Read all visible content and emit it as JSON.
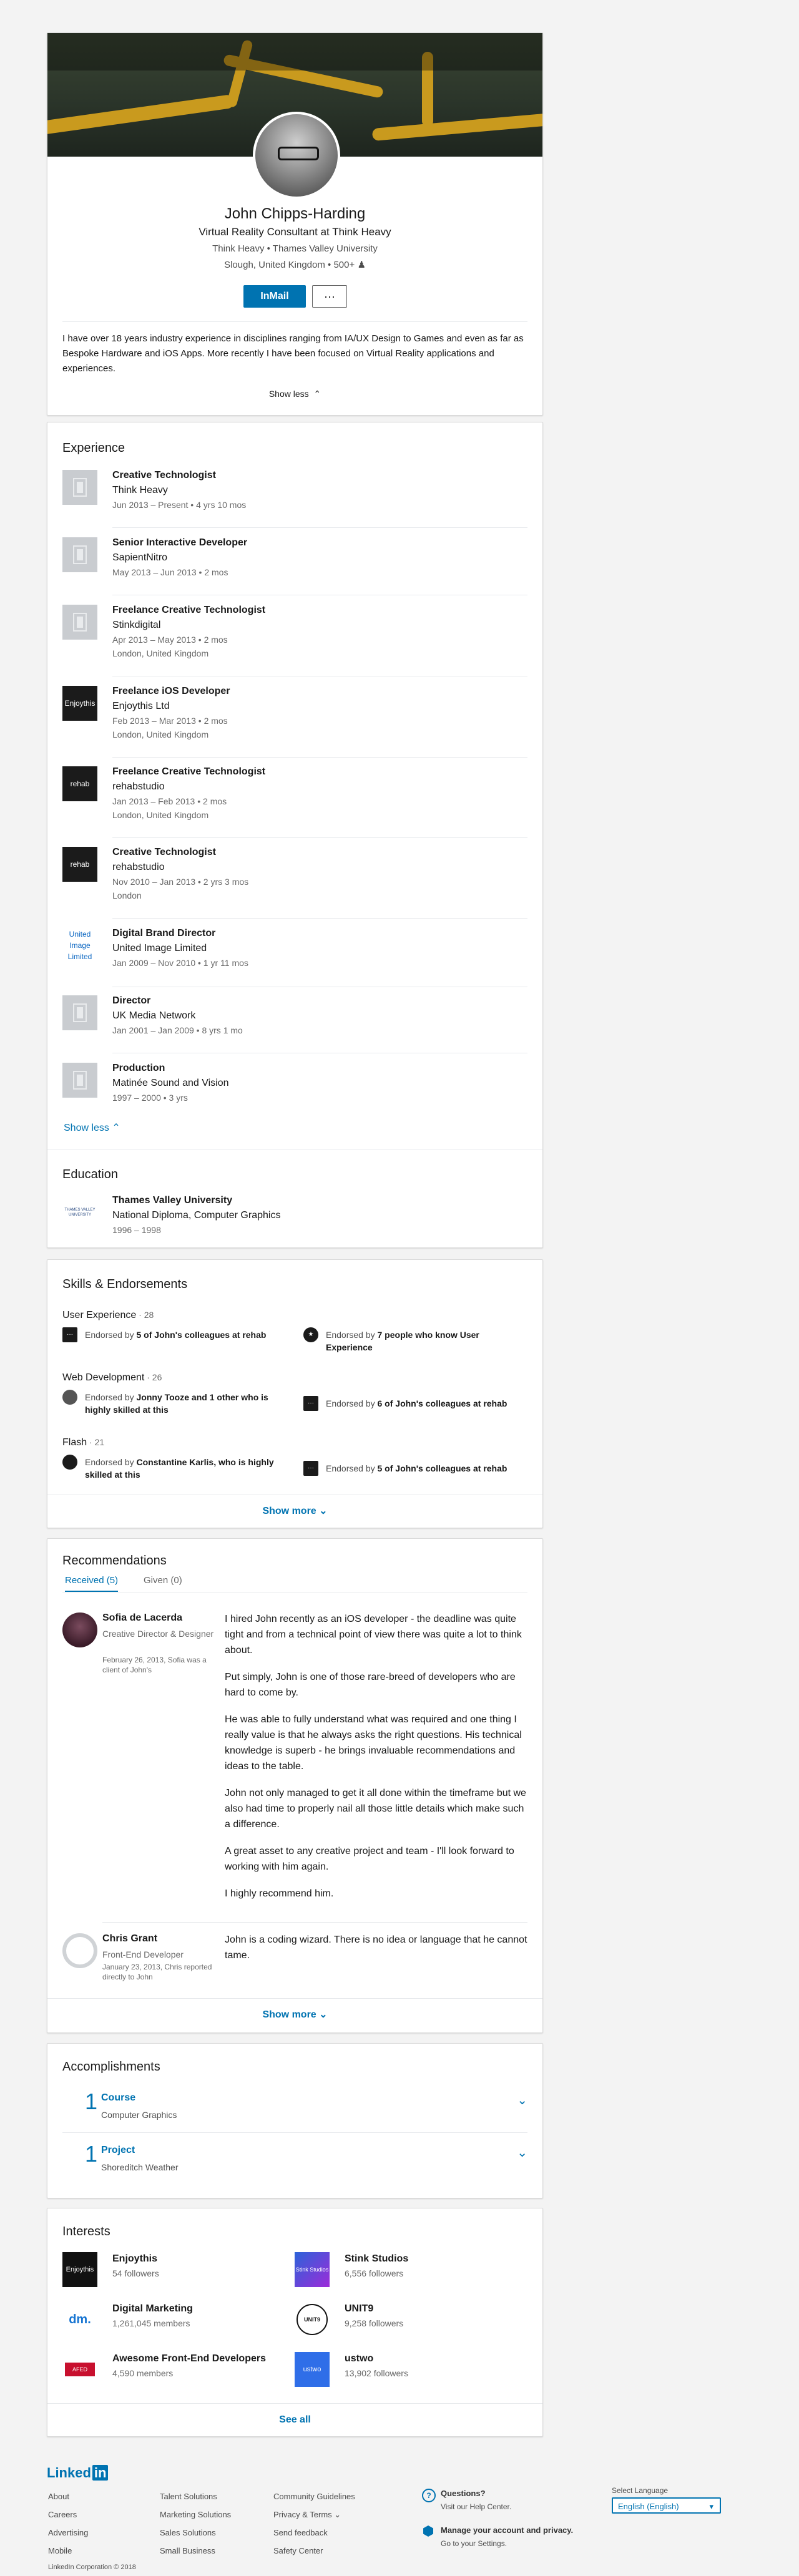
{
  "profile": {
    "name": "John Chipps-Harding",
    "headline": "Virtual Reality Consultant at Think Heavy",
    "company": "Think Heavy",
    "school": "Thames Valley University",
    "location": "Slough, United Kingdom",
    "connections": "500+",
    "inmail_label": "InMail",
    "more_label": "···",
    "summary": "I have over 18 years industry experience in disciplines ranging from IA/UX Design to Games and even as far as Bespoke Hardware and iOS Apps. More recently I have been focused on Virtual Reality applications and experiences.",
    "show_less": "Show less"
  },
  "experience": {
    "title": "Experience",
    "show_less": "Show less",
    "items": [
      {
        "title": "Creative Technologist",
        "company": "Think Heavy",
        "dates": "Jun 2013 – Present",
        "duration": "4 yrs 10 mos",
        "location": ""
      },
      {
        "title": "Senior Interactive Developer",
        "company": "SapientNitro",
        "dates": "May 2013 – Jun 2013",
        "duration": "2 mos",
        "location": ""
      },
      {
        "title": "Freelance Creative Technologist",
        "company": "Stinkdigital",
        "dates": "Apr 2013 – May 2013",
        "duration": "2 mos",
        "location": "London, United Kingdom"
      },
      {
        "title": "Freelance iOS Developer",
        "company": "Enjoythis Ltd",
        "dates": "Feb 2013 – Mar 2013",
        "duration": "2 mos",
        "location": "London, United Kingdom",
        "logo_text": "Enjoythis"
      },
      {
        "title": "Freelance Creative Technologist",
        "company": "rehabstudio",
        "dates": "Jan 2013 – Feb 2013",
        "duration": "2 mos",
        "location": "London, United Kingdom",
        "logo_text": "rehab"
      },
      {
        "title": "Creative Technologist",
        "company": "rehabstudio",
        "dates": "Nov 2010 – Jan 2013",
        "duration": "2 yrs 3 mos",
        "location": "London",
        "logo_text": "rehab"
      },
      {
        "title": "Digital Brand Director",
        "company": "United Image Limited",
        "dates": "Jan 2009 – Nov 2010",
        "duration": "1 yr 11 mos",
        "location": "",
        "logo_text": "United Image Limited"
      },
      {
        "title": "Director",
        "company": "UK Media Network",
        "dates": "Jan 2001 – Jan 2009",
        "duration": "8 yrs 1 mo",
        "location": ""
      },
      {
        "title": "Production",
        "company": "Matinée Sound and Vision",
        "dates": "1997 – 2000",
        "duration": "3 yrs",
        "location": ""
      }
    ]
  },
  "education": {
    "title": "Education",
    "school": "Thames Valley University",
    "degree": "National Diploma, Computer Graphics",
    "dates": "1996 – 1998",
    "logo_text": "THAMES VALLEY UNIVERSITY"
  },
  "skills": {
    "title": "Skills & Endorsements",
    "show_more": "Show more",
    "items": [
      {
        "name": "User Experience",
        "count": "28",
        "e1_pre": "Endorsed by ",
        "e1_bold": "5 of John's colleagues at rehab",
        "e1_post": "",
        "e2_pre": "Endorsed by ",
        "e2_bold": "7 people who know User Experience",
        "e2_post": ""
      },
      {
        "name": "Web Development",
        "count": "26",
        "e1_pre": "Endorsed by ",
        "e1_bold": "Jonny Tooze and 1 other who is highly skilled at this",
        "e1_post": "",
        "e2_pre": "Endorsed by ",
        "e2_bold": "6 of John's colleagues at rehab",
        "e2_post": ""
      },
      {
        "name": "Flash",
        "count": "21",
        "e1_pre": "Endorsed by ",
        "e1_bold": "Constantine Karlis, who is highly skilled at this",
        "e1_post": "",
        "e2_pre": "Endorsed by ",
        "e2_bold": "5 of John's colleagues at rehab",
        "e2_post": ""
      }
    ]
  },
  "recommendations": {
    "title": "Recommendations",
    "tab_received": "Received (5)",
    "tab_given": "Given (0)",
    "show_more": "Show more",
    "items": [
      {
        "name": "Sofia de Lacerda",
        "role": "Creative Director & Designer",
        "relation": "February 26, 2013, Sofia was a client of John's",
        "paragraphs": [
          "I hired John recently as an iOS developer - the deadline was quite tight and from a technical point of view there was quite a lot to think about.",
          "Put simply, John is one of those rare-breed of developers who are hard to come by.",
          "He was able to fully understand what was required and one thing I really value is that he always asks the right questions. His technical knowledge is superb - he brings invaluable recommendations and ideas to the table.",
          "John not only managed to get it all done within the timeframe but we also had time to properly nail all those little details which make such a difference.",
          "A great asset to any creative project and team - I'll look forward to working with him again.",
          "I highly recommend him."
        ]
      },
      {
        "name": "Chris Grant",
        "role": "Front-End Developer",
        "relation": "January 23, 2013, Chris reported directly to John",
        "paragraphs": [
          "John is a coding wizard. There is no idea or language that he cannot tame."
        ]
      }
    ]
  },
  "accomplishments": {
    "title": "Accomplishments",
    "items": [
      {
        "count": "1",
        "type": "Course",
        "value": "Computer Graphics"
      },
      {
        "count": "1",
        "type": "Project",
        "value": "Shoreditch Weather"
      }
    ]
  },
  "interests": {
    "title": "Interests",
    "see_all": "See all",
    "items": [
      {
        "name": "Enjoythis",
        "followers": "54 followers",
        "logo_text": "Enjoythis"
      },
      {
        "name": "Stink Studios",
        "followers": "6,556 followers",
        "logo_text": "Stink Studios"
      },
      {
        "name": "Digital Marketing",
        "followers": "1,261,045 members",
        "logo_text": "dm."
      },
      {
        "name": "UNIT9",
        "followers": "9,258 followers",
        "logo_text": "UNIT9"
      },
      {
        "name": "Awesome Front-End Developers",
        "followers": "4,590 members",
        "logo_text": "AFED"
      },
      {
        "name": "ustwo",
        "followers": "13,902 followers",
        "logo_text": "ustwo"
      }
    ]
  },
  "footer": {
    "logo_text": "Linked",
    "logo_in": "in",
    "col1": [
      "About",
      "Careers",
      "Advertising",
      "Mobile"
    ],
    "col2": [
      "Talent Solutions",
      "Marketing Solutions",
      "Sales Solutions",
      "Small Business"
    ],
    "col3": [
      "Community Guidelines",
      "Privacy & Terms",
      "Send feedback",
      "Safety Center"
    ],
    "questions_title": "Questions?",
    "questions_sub": "Visit our Help Center.",
    "manage_title": "Manage your account and privacy.",
    "manage_sub": "Go to your Settings.",
    "lang_label": "Select Language",
    "lang_value": "English (English)",
    "copyright": "LinkedIn Corporation © 2018"
  }
}
